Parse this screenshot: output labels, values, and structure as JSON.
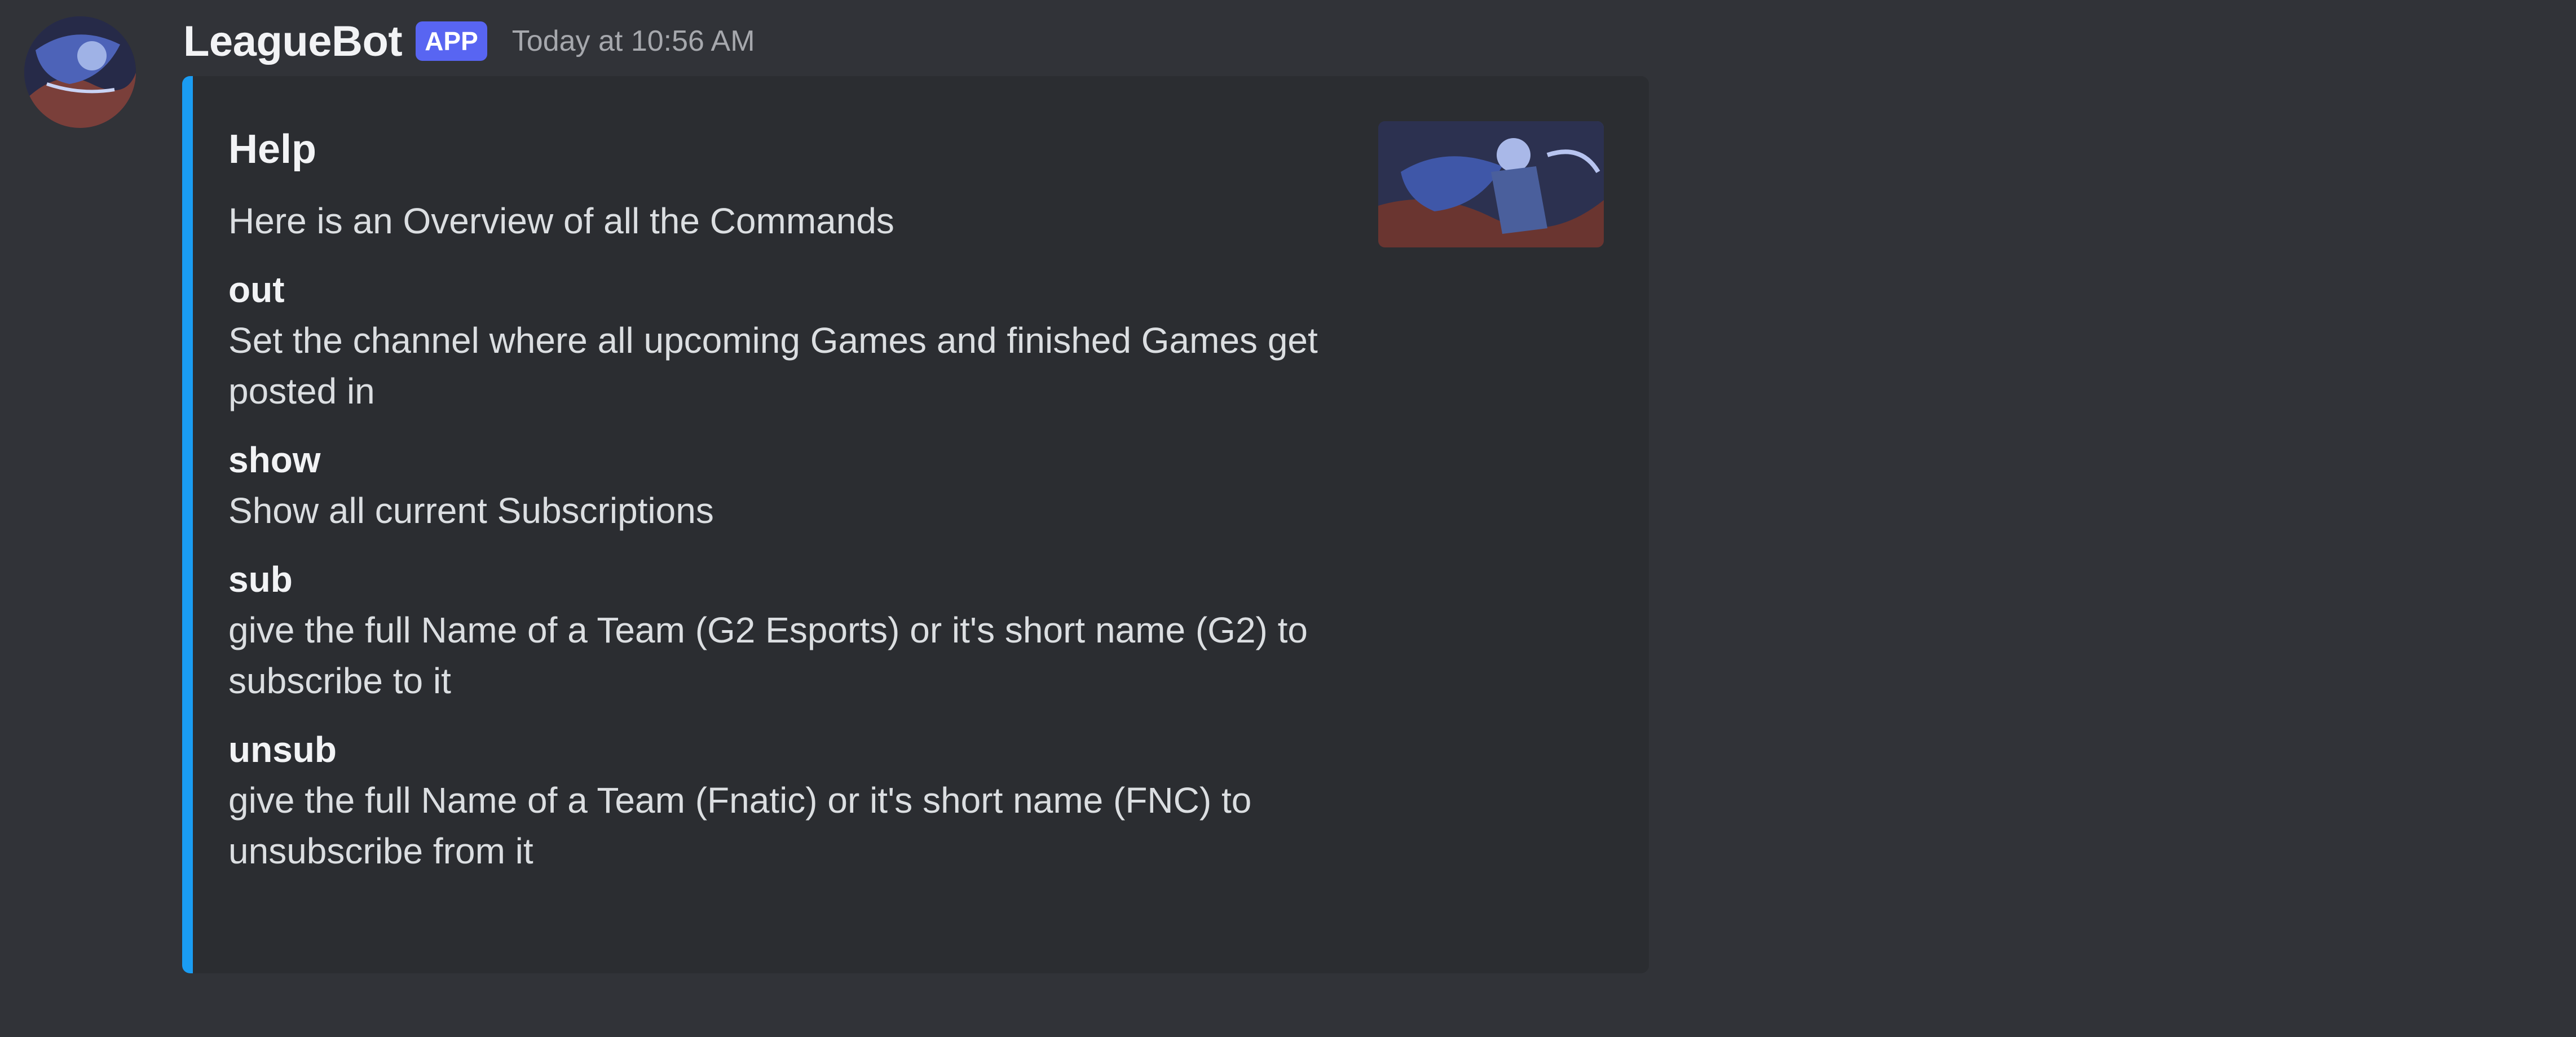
{
  "message": {
    "author": "LeagueBot",
    "badge": "APP",
    "timestamp": "Today at 10:56 AM",
    "avatar_icon": "avatar-image"
  },
  "embed": {
    "accent_color": "#1a9cf2",
    "title": "Help",
    "description": "Here is an Overview of all the Commands",
    "thumbnail": "thumbnail-image",
    "fields": [
      {
        "name": "out",
        "value": "Set the channel where all upcoming Games and finished Games get posted in"
      },
      {
        "name": "show",
        "value": "Show all current Subscriptions"
      },
      {
        "name": "sub",
        "value": "give the full Name of a Team (G2 Esports) or it's short name (G2) to subscribe to it"
      },
      {
        "name": "unsub",
        "value": "give the full Name of a Team (Fnatic) or it's short name (FNC) to unsubscribe from it"
      }
    ]
  },
  "colors": {
    "background": "#313338",
    "embed_background": "#2b2d31",
    "badge": "#5865f2"
  }
}
